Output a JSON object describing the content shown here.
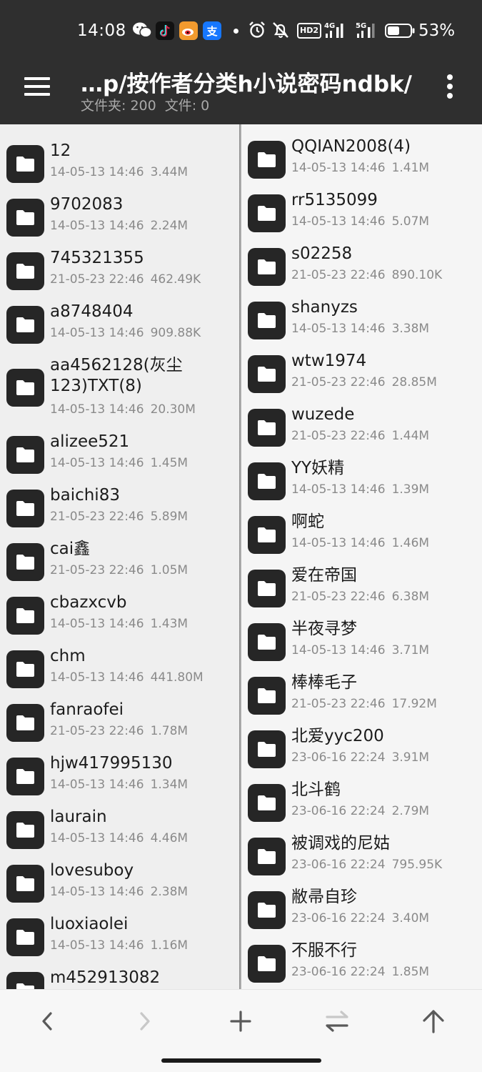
{
  "status_bar": {
    "time": "14:08",
    "app_icons": [
      "wechat-icon",
      "tiktok-icon",
      "weibo-icon",
      "alipay-icon"
    ],
    "alipay_label": "支",
    "hd_label": "HD2",
    "signal1_label": "4G",
    "signal2_label": "5G",
    "battery_percent": "53%",
    "battery_level": 0.53
  },
  "header": {
    "title": "…p/按作者分类h小说密码ndbk/",
    "folders_label": "文件夹: 200",
    "files_label": "文件: 0"
  },
  "left_items": [
    {
      "name": "12",
      "date": "14-05-13 14:46",
      "size": "3.44M"
    },
    {
      "name": "9702083",
      "date": "14-05-13 14:46",
      "size": "2.24M"
    },
    {
      "name": "745321355",
      "date": "21-05-23 22:46",
      "size": "462.49K"
    },
    {
      "name": "a8748404",
      "date": "14-05-13 14:46",
      "size": "909.88K"
    },
    {
      "name": "aa4562128(灰尘123)TXT(8)",
      "date": "14-05-13 14:46",
      "size": "20.30M"
    },
    {
      "name": "alizee521",
      "date": "14-05-13 14:46",
      "size": "1.45M"
    },
    {
      "name": "baichi83",
      "date": "21-05-23 22:46",
      "size": "5.89M"
    },
    {
      "name": "cai鑫",
      "date": "21-05-23 22:46",
      "size": "1.05M"
    },
    {
      "name": "cbazxcvb",
      "date": "14-05-13 14:46",
      "size": "1.43M"
    },
    {
      "name": "chm",
      "date": "14-05-13 14:46",
      "size": "441.80M"
    },
    {
      "name": "fanraofei",
      "date": "21-05-23 22:46",
      "size": "1.78M"
    },
    {
      "name": "hjw417995130",
      "date": "14-05-13 14:46",
      "size": "1.34M"
    },
    {
      "name": "laurain",
      "date": "14-05-13 14:46",
      "size": "4.46M"
    },
    {
      "name": "lovesuboy",
      "date": "14-05-13 14:46",
      "size": "2.38M"
    },
    {
      "name": "luoxiaolei",
      "date": "14-05-13 14:46",
      "size": "1.16M"
    },
    {
      "name": "m452913082",
      "date": "",
      "size": ""
    }
  ],
  "right_items": [
    {
      "name": "QQIAN2008(4)",
      "date": "14-05-13 14:46",
      "size": "1.41M"
    },
    {
      "name": "rr5135099",
      "date": "14-05-13 14:46",
      "size": "5.07M"
    },
    {
      "name": "s02258",
      "date": "21-05-23 22:46",
      "size": "890.10K"
    },
    {
      "name": "shanyzs",
      "date": "14-05-13 14:46",
      "size": "3.38M"
    },
    {
      "name": "wtw1974",
      "date": "21-05-23 22:46",
      "size": "28.85M"
    },
    {
      "name": "wuzede",
      "date": "21-05-23 22:46",
      "size": "1.44M"
    },
    {
      "name": "YY妖精",
      "date": "14-05-13 14:46",
      "size": "1.39M"
    },
    {
      "name": "啊蛇",
      "date": "14-05-13 14:46",
      "size": "1.46M"
    },
    {
      "name": "爱在帝国",
      "date": "21-05-23 22:46",
      "size": "6.38M"
    },
    {
      "name": "半夜寻梦",
      "date": "14-05-13 14:46",
      "size": "3.71M"
    },
    {
      "name": "棒棒毛子",
      "date": "21-05-23 22:46",
      "size": "17.92M"
    },
    {
      "name": "北爱yyc200",
      "date": "23-06-16 22:24",
      "size": "3.91M"
    },
    {
      "name": "北斗鹤",
      "date": "23-06-16 22:24",
      "size": "2.79M"
    },
    {
      "name": "被调戏的尼姑",
      "date": "23-06-16 22:24",
      "size": "795.95K"
    },
    {
      "name": "敝帚自珍",
      "date": "23-06-16 22:24",
      "size": "3.40M"
    },
    {
      "name": "不服不行",
      "date": "23-06-16 22:24",
      "size": "1.85M"
    }
  ],
  "bottom_bar": {
    "buttons": [
      "back-icon",
      "forward-icon",
      "add-icon",
      "swap-icon",
      "up-icon"
    ],
    "forward_enabled": false
  },
  "colors": {
    "header_bg": "#2f2f2f",
    "folder_icon_bg": "#262626",
    "meta_text": "#8a8a8a",
    "disabled_icon": "#bdbdbd",
    "active_icon": "#5a5a5a"
  }
}
